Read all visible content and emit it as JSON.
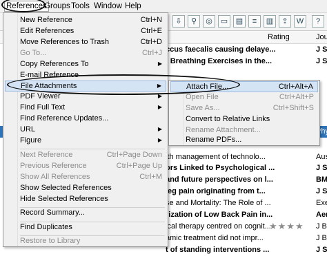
{
  "menubar": {
    "items": [
      {
        "label": "References"
      },
      {
        "label": "Groups"
      },
      {
        "label": "Tools"
      },
      {
        "label": "Window"
      },
      {
        "label": "Help"
      }
    ]
  },
  "columns": {
    "rating": "Rating",
    "journal": "Jou"
  },
  "background_rows": [
    {
      "title": "ccus faecalis causing delaye...",
      "journal": "J Sp",
      "bold": true
    },
    {
      "title": "f Breathing Exercises in the...",
      "journal": "J Sp",
      "bold": true
    },
    {
      "title": "",
      "journal": "",
      "bold": false
    },
    {
      "title": "",
      "journal": "",
      "bold": false
    },
    {
      "title": "",
      "journal": "",
      "bold": true
    },
    {
      "title": "",
      "journal": "",
      "bold": false
    },
    {
      "title": "",
      "journal": "",
      "bold": false
    },
    {
      "title": "",
      "journal": "",
      "bold": false
    },
    {
      "title": "",
      "journal": "Phy",
      "bold": false,
      "selected": true
    },
    {
      "title": "",
      "journal": "",
      "bold": false
    },
    {
      "title": "",
      "journal": "",
      "bold": false
    },
    {
      "title": "ith management of technolo...",
      "journal": "Aus",
      "bold": false
    },
    {
      "title": "ors Linked to Psychological ...",
      "journal": "J Sp",
      "bold": true
    },
    {
      "title": "and future perspectives on l...",
      "journal": "BM",
      "bold": true
    },
    {
      "title": "leg pain originating from t...",
      "journal": "J Sp",
      "bold": true
    },
    {
      "title": "se and Mortality: The Role of ...",
      "journal": "Exe",
      "bold": false
    },
    {
      "title": "rization of Low Back Pain in...",
      "journal": "Aer",
      "bold": true
    },
    {
      "title": "ical therapy centred on cognit...",
      "journal": "J Be",
      "bold": false,
      "rating": "★★★★"
    },
    {
      "title": "amic treatment did not impr...",
      "journal": "J Bi",
      "bold": false
    },
    {
      "title": "t of standing interventions ...",
      "journal": "J Sp",
      "bold": true
    }
  ],
  "menu": {
    "items": [
      {
        "label": "New Reference",
        "shortcut": "Ctrl+N"
      },
      {
        "label": "Edit References",
        "shortcut": "Ctrl+E"
      },
      {
        "label": "Move References to Trash",
        "shortcut": "Ctrl+D"
      },
      {
        "label": "Go To...",
        "shortcut": "Ctrl+J",
        "disabled": true
      },
      {
        "label": "Copy References To",
        "shortcut": "",
        "submenu": true
      },
      {
        "label": "E-mail Reference",
        "shortcut": ""
      },
      {
        "label": "File Attachments",
        "shortcut": "",
        "submenu": true,
        "highlighted": true
      },
      {
        "label": "PDF Viewer",
        "shortcut": "",
        "submenu": true
      },
      {
        "label": "Find Full Text",
        "shortcut": "",
        "submenu": true
      },
      {
        "label": "Find Reference Updates...",
        "shortcut": ""
      },
      {
        "label": "URL",
        "shortcut": "",
        "submenu": true
      },
      {
        "label": "Figure",
        "shortcut": "",
        "submenu": true
      },
      {
        "label": "Next Reference",
        "shortcut": "Ctrl+Page Down",
        "disabled": true
      },
      {
        "label": "Previous Reference",
        "shortcut": "Ctrl+Page Up",
        "disabled": true
      },
      {
        "label": "Show All References",
        "shortcut": "Ctrl+M",
        "disabled": true
      },
      {
        "label": "Show Selected References",
        "shortcut": ""
      },
      {
        "label": "Hide Selected References",
        "shortcut": ""
      },
      {
        "label": "Record Summary...",
        "shortcut": ""
      },
      {
        "label": "Find Duplicates",
        "shortcut": ""
      },
      {
        "label": "Restore to Library",
        "shortcut": "",
        "disabled": true
      }
    ]
  },
  "submenu": {
    "items": [
      {
        "label": "Attach File...",
        "shortcut": "Ctrl+Alt+A",
        "highlighted": true
      },
      {
        "label": "Open File",
        "shortcut": "Ctrl+Alt+P",
        "disabled": true
      },
      {
        "label": "Save As...",
        "shortcut": "Ctrl+Shift+S",
        "disabled": true
      },
      {
        "label": "Convert to Relative Links",
        "shortcut": ""
      },
      {
        "label": "Rename Attachment...",
        "shortcut": "",
        "disabled": true
      },
      {
        "label": "Rename PDFs...",
        "shortcut": ""
      }
    ]
  },
  "colors": {
    "selection": "#2e73b8",
    "highlight": "#d5e4f5",
    "menu_bg": "#f0f0f0"
  }
}
